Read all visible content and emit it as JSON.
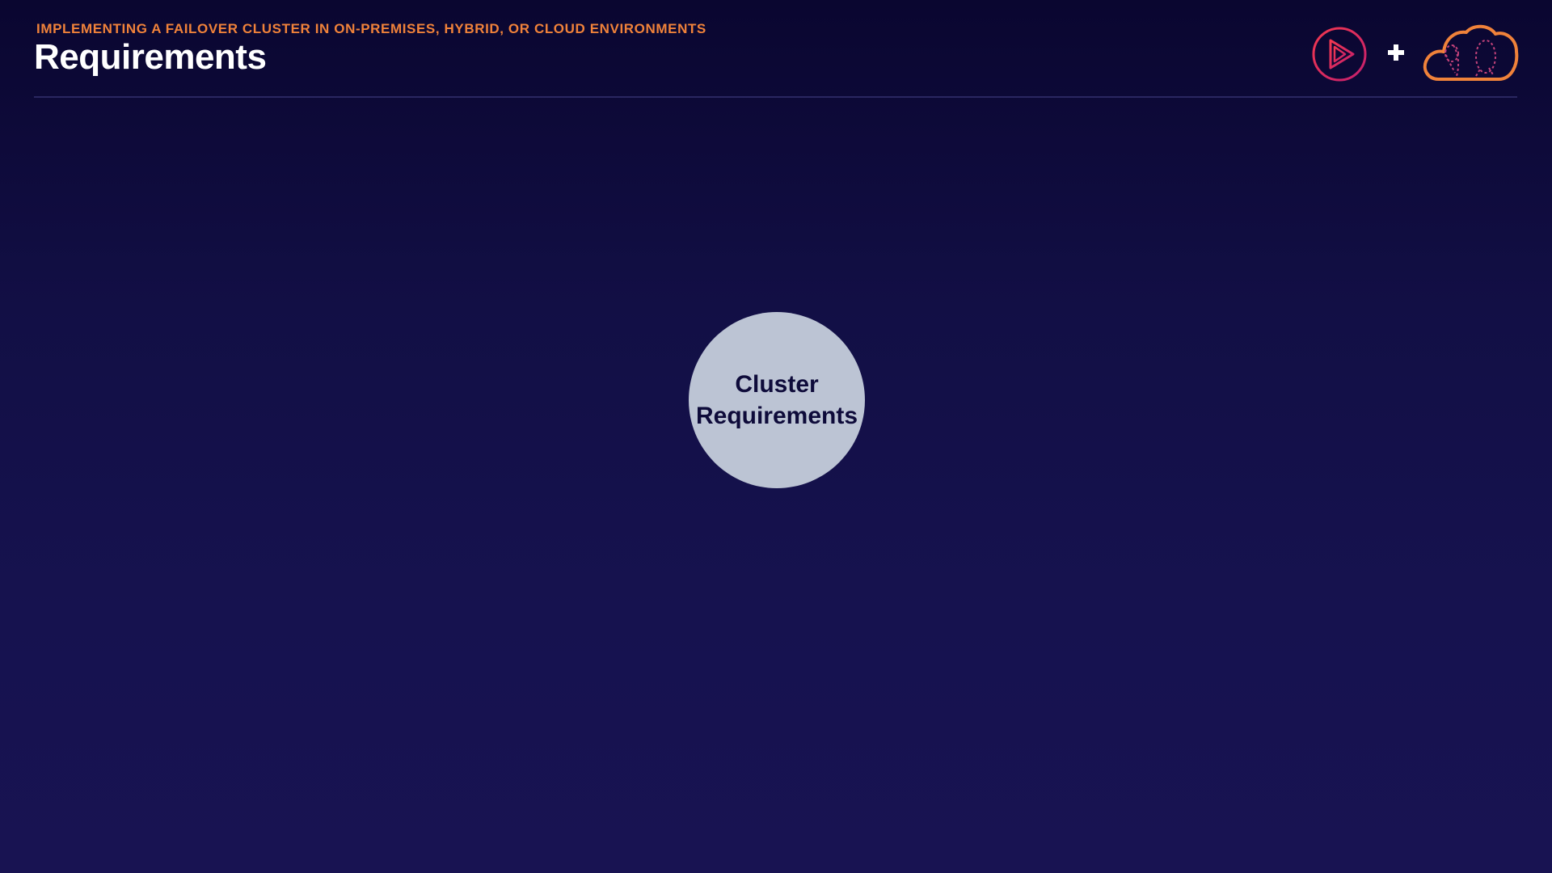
{
  "header": {
    "subtitle": "IMPLEMENTING A FAILOVER CLUSTER IN ON-PREMISES, HYBRID, OR CLOUD ENVIRONMENTS",
    "title": "Requirements"
  },
  "logos": {
    "left_icon": "play-logo-icon",
    "separator_icon": "plus-icon",
    "right_icon": "cloud-logo-icon"
  },
  "diagram": {
    "node": {
      "line1": "Cluster",
      "line2": "Requirements"
    }
  },
  "colors": {
    "accent": "#f0823a",
    "play_logo": "#e8325a",
    "node_fill": "#bcc4d4",
    "background": "#120f45"
  }
}
